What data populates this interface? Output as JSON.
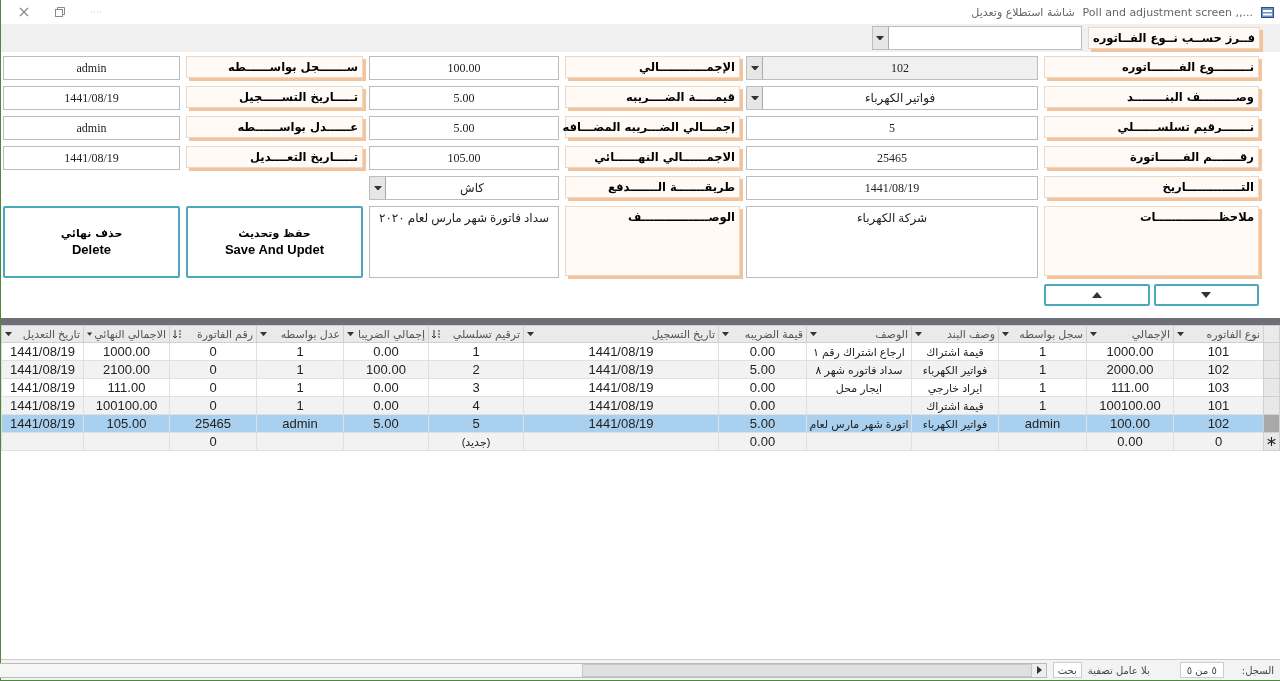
{
  "window": {
    "title": "...,, Poll and adjustment screen",
    "subtitle": "شاشة استطلاع وتعديل"
  },
  "sort": {
    "label": "فــرز حســب نــوع الفــاتوره"
  },
  "form": {
    "rows": [
      {
        "cells": [
          {
            "label": "نـــــــــوع الفـــــــاتوره",
            "value": "102",
            "kind": "dropdown",
            "readonly": true
          },
          {
            "label": "الإجمــــــــــــالي",
            "value": "100.00",
            "kind": "text",
            "readonly": false
          },
          {
            "label": "ســـــــجل بواســــــطه",
            "value": "admin",
            "kind": "text",
            "readonly": false
          }
        ]
      },
      {
        "cells": [
          {
            "label": "وصـــــــــف البنــــــــد",
            "value": "فواتير الكهرباء",
            "kind": "dropdown",
            "readonly": false
          },
          {
            "label": "قيمـــــة الضــــريبه",
            "value": "5.00",
            "kind": "text",
            "readonly": false
          },
          {
            "label": "تـــــاريخ التســـــجيل",
            "value": "1441/08/19",
            "kind": "text",
            "readonly": false
          }
        ]
      },
      {
        "cells": [
          {
            "label": "نـــــــرقيم تسلســــــلي",
            "value": "5",
            "kind": "text",
            "readonly": false
          },
          {
            "label": "إجمـــالي الضـــريبه المضـــافه",
            "value": "5.00",
            "kind": "text",
            "readonly": false
          },
          {
            "label": "عــــــدل بواســــــطه",
            "value": "admin",
            "kind": "text",
            "readonly": false
          }
        ]
      },
      {
        "cells": [
          {
            "label": "رقـــــــم الفــــــاتورة",
            "value": "25465",
            "kind": "text",
            "readonly": false
          },
          {
            "label": "الاجمــــــالي النهــــــائي",
            "value": "105.00",
            "kind": "text",
            "readonly": false
          },
          {
            "label": "تـــــاريخ التعــــديل",
            "value": "1441/08/19",
            "kind": "text",
            "readonly": false
          }
        ]
      },
      {
        "cells": [
          {
            "label": "التــــــــــــــاريخ",
            "value": "1441/08/19",
            "kind": "text",
            "readonly": false
          },
          {
            "label": "طريقـــــــة الـــــــدفع",
            "value": "كاش",
            "kind": "dropdown",
            "readonly": false
          }
        ]
      }
    ],
    "notes": {
      "label": "ملاحظــــــــــــــــات",
      "value": "شركة الكهرباء"
    },
    "description": {
      "label": "الوصـــــــــــــــــف",
      "value": "سداد فاتورة شهر مارس لعام ٢٠٢٠"
    },
    "buttons": [
      {
        "line1": "حفظ وتحديث",
        "line2": "Save And Updet"
      },
      {
        "line1": "حذف نهائي",
        "line2": "Delete"
      }
    ]
  },
  "grid": {
    "columns": [
      {
        "label": "نوع الفاتوره",
        "sorted": false
      },
      {
        "label": "الإجمالي",
        "sorted": false
      },
      {
        "label": "سجل بواسطه",
        "sorted": false
      },
      {
        "label": "وصف البند",
        "sorted": false
      },
      {
        "label": "الوصف",
        "sorted": false
      },
      {
        "label": "قيمة الضريبه",
        "sorted": false
      },
      {
        "label": "تاريخ التسجيل",
        "sorted": false
      },
      {
        "label": "ترقيم تسلسلي",
        "sorted": true
      },
      {
        "label": "إجمالي الضريبا",
        "sorted": false
      },
      {
        "label": "عدل بواسطه",
        "sorted": false
      },
      {
        "label": "رقم الفاتورة",
        "sorted": true
      },
      {
        "label": "الاجمالي النهائي",
        "sorted": false
      },
      {
        "label": "تاريخ التعديل",
        "sorted": false
      }
    ],
    "rows": [
      {
        "kind": "record",
        "selected": false,
        "cells": [
          "101",
          "1000.00",
          "1",
          "قيمة اشتراك",
          "ارجاع اشتراك رقم ١",
          "0.00",
          "1441/08/19",
          "1",
          "0.00",
          "1",
          "0",
          "1000.00",
          "1441/08/19"
        ]
      },
      {
        "kind": "record",
        "selected": false,
        "cells": [
          "102",
          "2000.00",
          "1",
          "فواتير الكهرباء",
          "سداد فاتوره شهر ٨",
          "5.00",
          "1441/08/19",
          "2",
          "100.00",
          "1",
          "0",
          "2100.00",
          "1441/08/19"
        ]
      },
      {
        "kind": "record",
        "selected": false,
        "cells": [
          "103",
          "111.00",
          "1",
          "ايراد خارجي",
          "ايجار محل",
          "0.00",
          "1441/08/19",
          "3",
          "0.00",
          "1",
          "0",
          "111.00",
          "1441/08/19"
        ]
      },
      {
        "kind": "record",
        "selected": false,
        "cells": [
          "101",
          "100100.00",
          "1",
          "قيمة اشتراك",
          null,
          "0.00",
          "1441/08/19",
          "4",
          "0.00",
          "1",
          "0",
          "100100.00",
          "1441/08/19"
        ]
      },
      {
        "kind": "record",
        "selected": true,
        "cells": [
          "102",
          "100.00",
          "admin",
          "فواتير الكهرباء",
          "اتورة شهر مارس لعام",
          "5.00",
          "1441/08/19",
          "5",
          "5.00",
          "admin",
          "25465",
          "105.00",
          "1441/08/19"
        ]
      },
      {
        "kind": "new",
        "selected": false,
        "cells": [
          "0",
          "0.00",
          null,
          null,
          null,
          "0.00",
          null,
          "(جديد)",
          null,
          null,
          "0",
          null,
          null
        ]
      }
    ]
  },
  "status_bar": {
    "record_label": "السجل:",
    "record_position": "٥ من ٥",
    "filter": "بلا عامل تصفية",
    "search": "بحث"
  }
}
